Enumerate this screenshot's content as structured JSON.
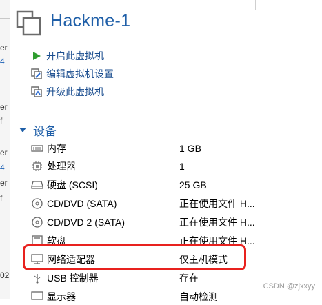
{
  "vm": {
    "name": "Hackme-1"
  },
  "left_strip": {
    "fragments": [
      "er",
      "4",
      "er",
      "f",
      "er",
      "4",
      "er",
      "f",
      "02"
    ]
  },
  "actions": [
    {
      "label": "开启此虚拟机",
      "icon": "play-icon"
    },
    {
      "label": "编辑虚拟机设置",
      "icon": "edit-settings-icon"
    },
    {
      "label": "升级此虚拟机",
      "icon": "upgrade-icon"
    }
  ],
  "devices_section": {
    "title": "设备"
  },
  "devices": [
    {
      "name": "内存",
      "value": "1 GB",
      "icon": "memory-icon"
    },
    {
      "name": "处理器",
      "value": "1",
      "icon": "cpu-icon"
    },
    {
      "name": "硬盘 (SCSI)",
      "value": "25 GB",
      "icon": "harddisk-icon"
    },
    {
      "name": "CD/DVD (SATA)",
      "value": "正在使用文件 H...",
      "icon": "cd-dvd-icon"
    },
    {
      "name": "CD/DVD 2 (SATA)",
      "value": "正在使用文件 H...",
      "icon": "cd-dvd-icon"
    },
    {
      "name": "软盘",
      "value": "正在使用文件 H...",
      "icon": "floppy-icon"
    },
    {
      "name": "网络适配器",
      "value": "仅主机模式",
      "icon": "network-adapter-icon"
    },
    {
      "name": "USB 控制器",
      "value": "存在",
      "icon": "usb-icon"
    },
    {
      "name": "显示器",
      "value": "自动检测",
      "icon": "monitor-icon"
    }
  ],
  "colors": {
    "title": "#1f5fa8",
    "link": "#1a4d8f",
    "highlight": "#e8211e",
    "play": "#2e9d2e"
  },
  "watermark": "CSDN @zjxxyy"
}
